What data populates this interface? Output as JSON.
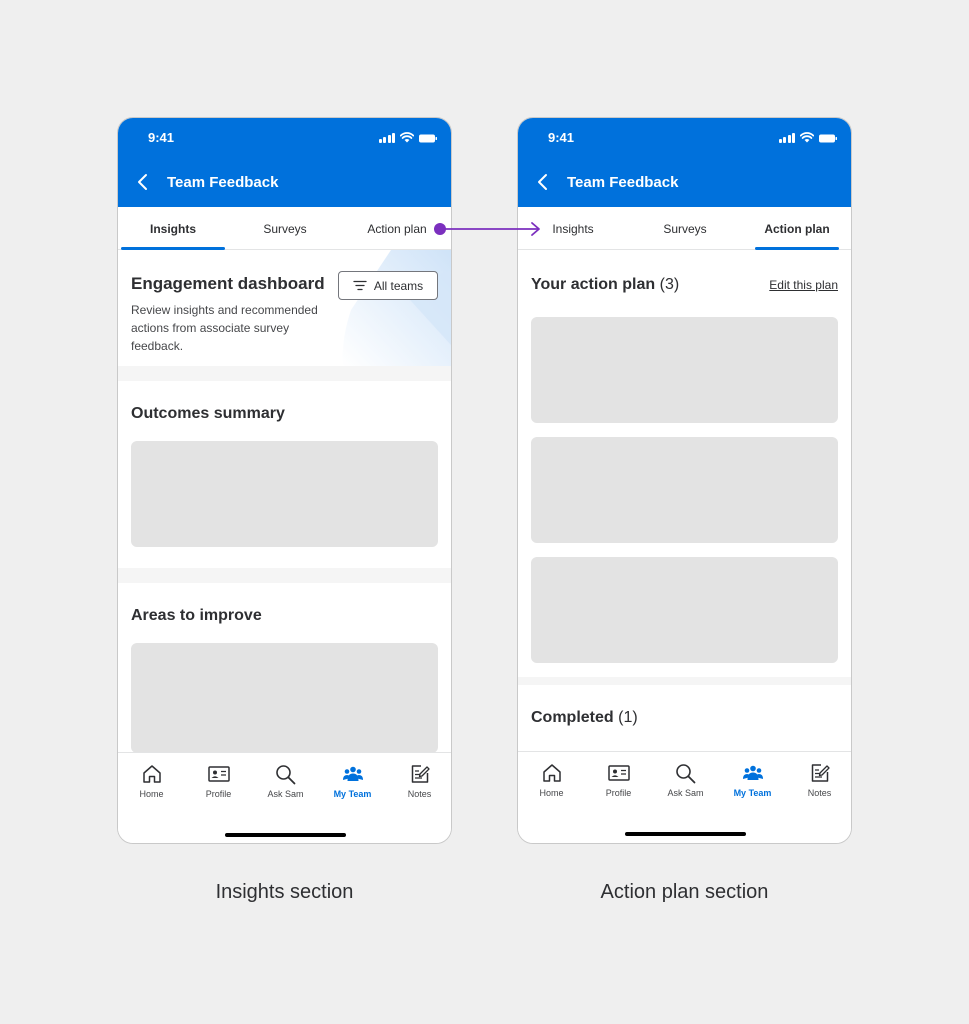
{
  "status_bar": {
    "time": "9:41"
  },
  "header": {
    "title": "Team Feedback"
  },
  "tabs": [
    "Insights",
    "Surveys",
    "Action plan"
  ],
  "insights": {
    "dashboard_title": "Engagement dashboard",
    "dashboard_description": "Review insights and recommended actions from associate survey feedback.",
    "filter_label": "All teams",
    "outcomes_title": "Outcomes summary",
    "areas_title": "Areas to improve"
  },
  "action_plan": {
    "title": "Your action plan",
    "title_count": "(3)",
    "edit_link": "Edit this plan",
    "completed_title": "Completed",
    "completed_count": "(1)"
  },
  "bottom_nav": [
    "Home",
    "Profile",
    "Ask Sam",
    "My Team",
    "Notes"
  ],
  "active_nav": "My Team",
  "captions": {
    "left": "Insights section",
    "right": "Action plan section"
  },
  "colors": {
    "brand_blue": "#0071dc",
    "flow_arrow": "#7b2fbe",
    "placeholder": "#e3e3e3"
  }
}
